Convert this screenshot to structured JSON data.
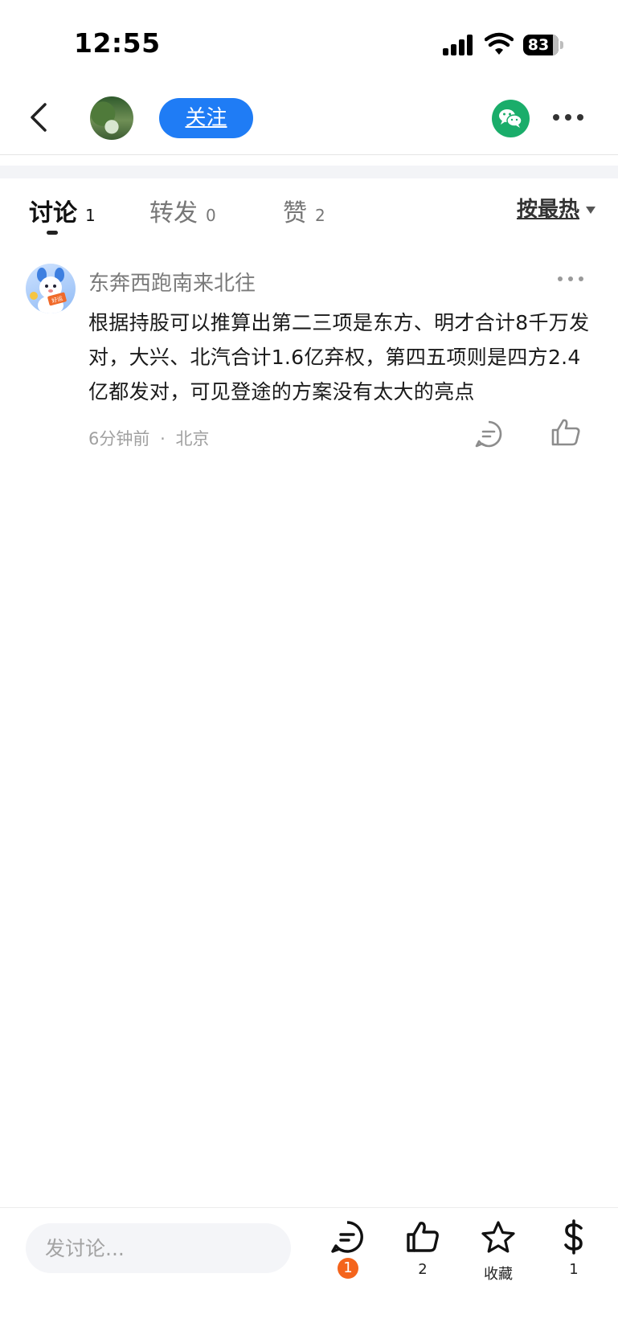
{
  "status_bar": {
    "time": "12:55",
    "battery": "83",
    "battery_level": 0.83
  },
  "nav": {
    "follow_label": "关注"
  },
  "tabs": [
    {
      "label": "讨论",
      "count": "1",
      "active": true
    },
    {
      "label": "转发",
      "count": "0",
      "active": false
    },
    {
      "label": "赞",
      "count": "2",
      "active": false
    }
  ],
  "sort": {
    "label": "按最热"
  },
  "comment": {
    "username": "东奔西跑南来北往",
    "text": "根据持股可以推算出第二三项是东方、明才合计8千万发对，大兴、北汽合计1.6亿弃权，第四五项则是四方2.4亿都发对，可见登途的方案没有太大的亮点",
    "time": "6分钟前",
    "separator": "·",
    "location": "北京",
    "avatar_badge": "好运"
  },
  "bottom_bar": {
    "input_placeholder": "发讨论...",
    "comment_badge": "1",
    "like_count": "2",
    "favorite_label": "收藏",
    "reward_count": "1"
  },
  "colors": {
    "accent": "#1f7cf5",
    "wechat": "#1aad6a",
    "badge": "#f4641c"
  }
}
